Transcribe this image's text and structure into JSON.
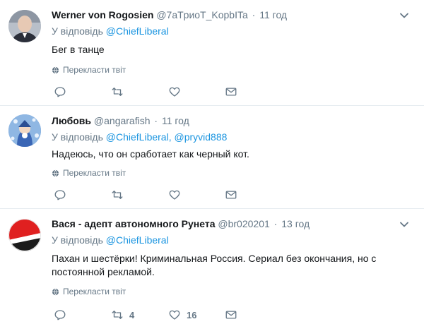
{
  "tweets": [
    {
      "name": "Werner von Rogosien",
      "handle": "@7aTpиoT_KopbITa",
      "time": "11 год",
      "reply_prefix": "У відповідь",
      "reply_to": [
        "@ChiefLiberal"
      ],
      "text": "Бег в танце",
      "translate": "Перекласти твіт",
      "reply_count": "",
      "retweet_count": "",
      "like_count": ""
    },
    {
      "name": "Любовь",
      "handle": "@angarafish",
      "time": "11 год",
      "reply_prefix": "У відповідь",
      "reply_to": [
        "@ChiefLiberal,",
        "@pryvid888"
      ],
      "text": "Надеюсь, что он сработает как черный кот.",
      "translate": "Перекласти твіт",
      "reply_count": "",
      "retweet_count": "",
      "like_count": ""
    },
    {
      "name": "Вася - адепт автономного Рунета",
      "handle": "@br020201",
      "time": "13 год",
      "reply_prefix": "У відповідь",
      "reply_to": [
        "@ChiefLiberal"
      ],
      "text": "Пахан и шестёрки! Криминальная Россия. Сериал без окончания, но с постоянной рекламой.",
      "translate": "Перекласти твіт",
      "reply_count": "",
      "retweet_count": "4",
      "like_count": "16"
    }
  ]
}
